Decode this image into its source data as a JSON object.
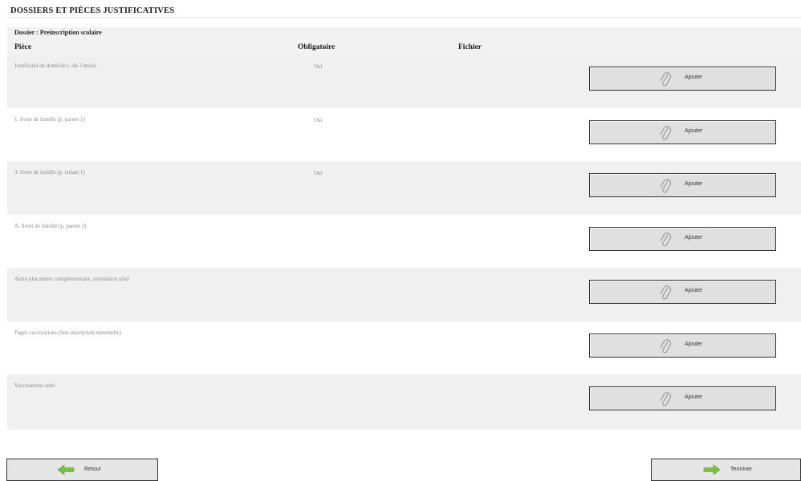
{
  "section": {
    "title": "DOSSIERS ET PIÈCES JUSTIFICATIVES"
  },
  "dossier": {
    "label": "Dossier : Preinscription scolaire"
  },
  "columns": {
    "piece": "Pièce",
    "obligatoire": "Obligatoire",
    "fichier": "Fichier"
  },
  "pieces": [
    {
      "label": "Justificatif de domicile (- de 3 mois)",
      "obligatoire": "Oui",
      "button": "Ajouter"
    },
    {
      "label": "1. livret de famille (p. parent 1)",
      "obligatoire": "Oui",
      "button": "Ajouter"
    },
    {
      "label": "3. livret de famille (p. enfant 1)",
      "obligatoire": "Oui",
      "button": "Ajouter"
    },
    {
      "label": "A. livret de famille (p. parent 2)",
      "obligatoire": "",
      "button": "Ajouter"
    },
    {
      "label": "Autre (document complémentaire, orientation ulis)",
      "obligatoire": "",
      "button": "Ajouter"
    },
    {
      "label": "Pages vaccinations (lien inscription maternelle)",
      "obligatoire": "",
      "button": "Ajouter"
    },
    {
      "label": "Vaccinations suite",
      "obligatoire": "",
      "button": "Ajouter"
    }
  ],
  "footer": {
    "back_label": "Retour",
    "finish_label": "Terminer"
  },
  "icons": {
    "attach": "paperclip-icon",
    "back": "arrow-left-icon",
    "finish": "arrow-right-icon"
  },
  "colors": {
    "arrow_green": "#7cc242",
    "panel_bg": "#f2f2f2",
    "button_bg": "#e0e0e0"
  }
}
